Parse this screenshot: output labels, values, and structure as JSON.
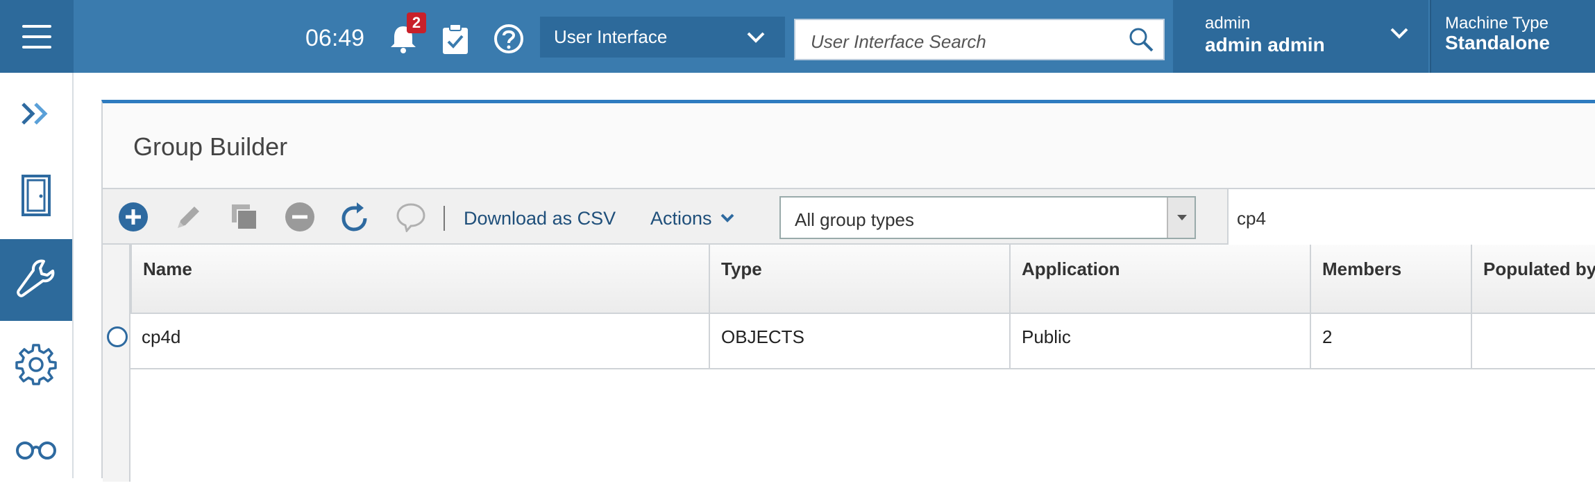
{
  "header": {
    "time": "06:49",
    "notification_count": "2",
    "scope_select": "User Interface",
    "search_placeholder": "User Interface Search",
    "user_role": "admin",
    "user_name": "admin admin",
    "machine_label": "Machine Type",
    "machine_value": "Standalone"
  },
  "sidebar": {
    "items": [
      {
        "icon": "expand-chevrons-icon"
      },
      {
        "icon": "door-icon"
      },
      {
        "icon": "wrench-icon",
        "active": true
      },
      {
        "icon": "gear-icon"
      },
      {
        "icon": "glasses-icon"
      }
    ]
  },
  "panel": {
    "title": "Group Builder"
  },
  "toolbar": {
    "download_csv": "Download as CSV",
    "actions": "Actions",
    "group_type_filter": "All group types",
    "search_value": "cp4"
  },
  "table": {
    "columns": [
      "Name",
      "Type",
      "Application",
      "Members",
      "Populated by"
    ],
    "rows": [
      {
        "name": "cp4d",
        "type": "OBJECTS",
        "application": "Public",
        "members": "2",
        "populated_by": ""
      }
    ]
  },
  "colors": {
    "header_bg": "#3a7bae",
    "header_dark": "#2d6a9b",
    "accent_blue": "#2e7bbf",
    "badge_red": "#c8202a"
  }
}
